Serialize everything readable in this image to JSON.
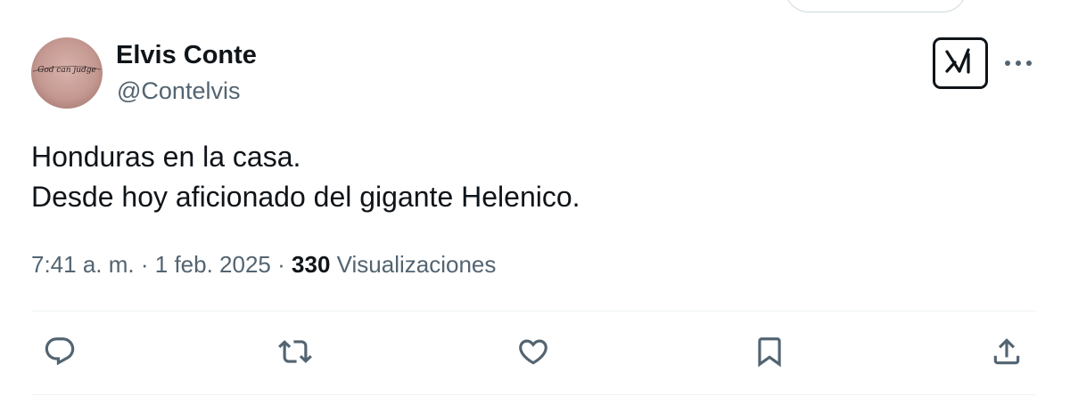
{
  "tweet": {
    "author": {
      "display_name": "Elvis Conte",
      "handle": "@Contelvis",
      "avatar_icon": "avatar-photo-tattoo"
    },
    "text_lines": [
      "Honduras en la casa.",
      "Desde hoy aficionado del gigante Helenico."
    ],
    "time": "7:41 a. m.",
    "separator": "·",
    "date": "1 feb. 2025",
    "views_count": "330",
    "views_label": "Visualizaciones"
  },
  "header_actions": {
    "grok_icon": "grok-icon",
    "more_icon": "more-dots-icon"
  },
  "action_bar": [
    {
      "icon": "reply-icon"
    },
    {
      "icon": "retweet-icon"
    },
    {
      "icon": "like-icon"
    },
    {
      "icon": "bookmark-icon"
    },
    {
      "icon": "share-icon"
    }
  ],
  "colors": {
    "text_primary": "#0f1419",
    "text_secondary": "#536471",
    "divider": "#eff3f4"
  }
}
